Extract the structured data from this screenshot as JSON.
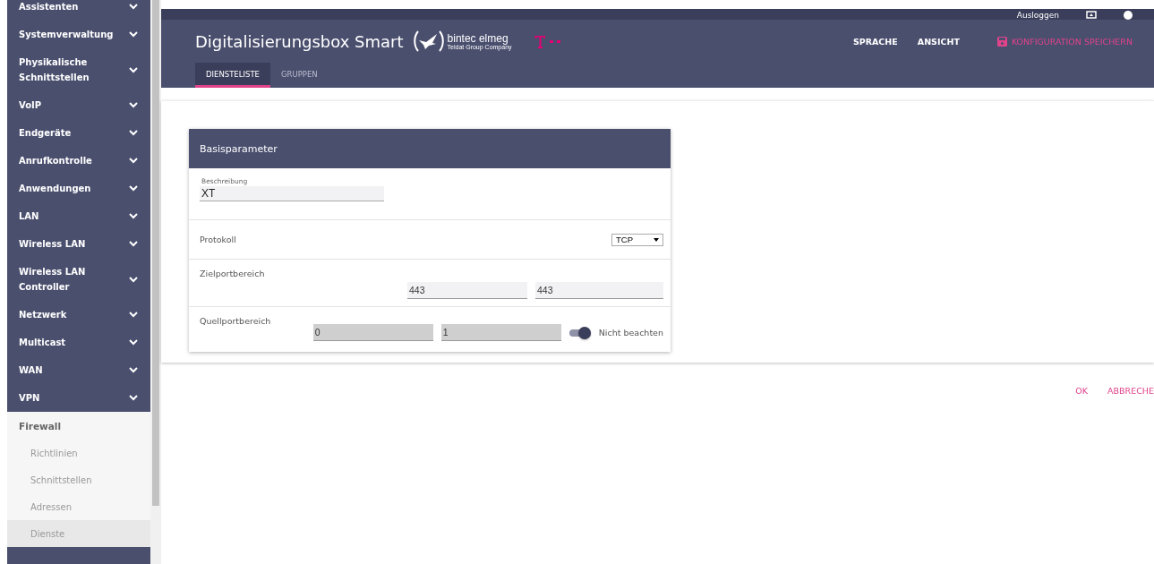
{
  "sidebar": {
    "groups": [
      {
        "label": "Assistenten",
        "expanded": false
      },
      {
        "label": "Systemverwaltung",
        "expanded": false
      },
      {
        "label": "Physikalische Schnittstellen",
        "expanded": false
      },
      {
        "label": "VoIP",
        "expanded": false
      },
      {
        "label": "Endgeräte",
        "expanded": false
      },
      {
        "label": "Anrufkontrolle",
        "expanded": false
      },
      {
        "label": "Anwendungen",
        "expanded": false
      },
      {
        "label": "LAN",
        "expanded": false
      },
      {
        "label": "Wireless LAN",
        "expanded": false
      },
      {
        "label": "Wireless LAN Controller",
        "expanded": false
      },
      {
        "label": "Netzwerk",
        "expanded": false
      },
      {
        "label": "Multicast",
        "expanded": false
      },
      {
        "label": "WAN",
        "expanded": false
      },
      {
        "label": "VPN",
        "expanded": false
      }
    ],
    "section": {
      "label": "Firewall",
      "items": [
        {
          "label": "Richtlinien",
          "selected": false
        },
        {
          "label": "Schnittstellen",
          "selected": false
        },
        {
          "label": "Adressen",
          "selected": false
        },
        {
          "label": "Dienste",
          "selected": true
        }
      ]
    }
  },
  "topbar": {
    "logout": "Ausloggen"
  },
  "header": {
    "title": "Digitalisierungsbox Smart",
    "brand": "bintec elmeg",
    "brand_sub": "Teldat Group Company",
    "actions": [
      "SPRACHE",
      "ANSICHT"
    ],
    "save": "KONFIGURATION SPEICHERN"
  },
  "tabs": [
    {
      "label": "DIENSTELISTE",
      "selected": true
    },
    {
      "label": "GRUPPEN",
      "selected": false
    }
  ],
  "card": {
    "title": "Basisparameter",
    "description": {
      "label": "Beschreibung",
      "value": "XT"
    },
    "protocol": {
      "label": "Protokoll",
      "value": "TCP"
    },
    "dest_range": {
      "label": "Zielportbereich",
      "from": "443",
      "to": "443"
    },
    "source_range": {
      "label": "Quellportbereich",
      "from": "0",
      "to": "1",
      "ignore_label": "Nicht beachten",
      "ignore_on": true
    }
  },
  "footer": {
    "buttons": [
      "OK",
      "ABBRECHE"
    ]
  }
}
